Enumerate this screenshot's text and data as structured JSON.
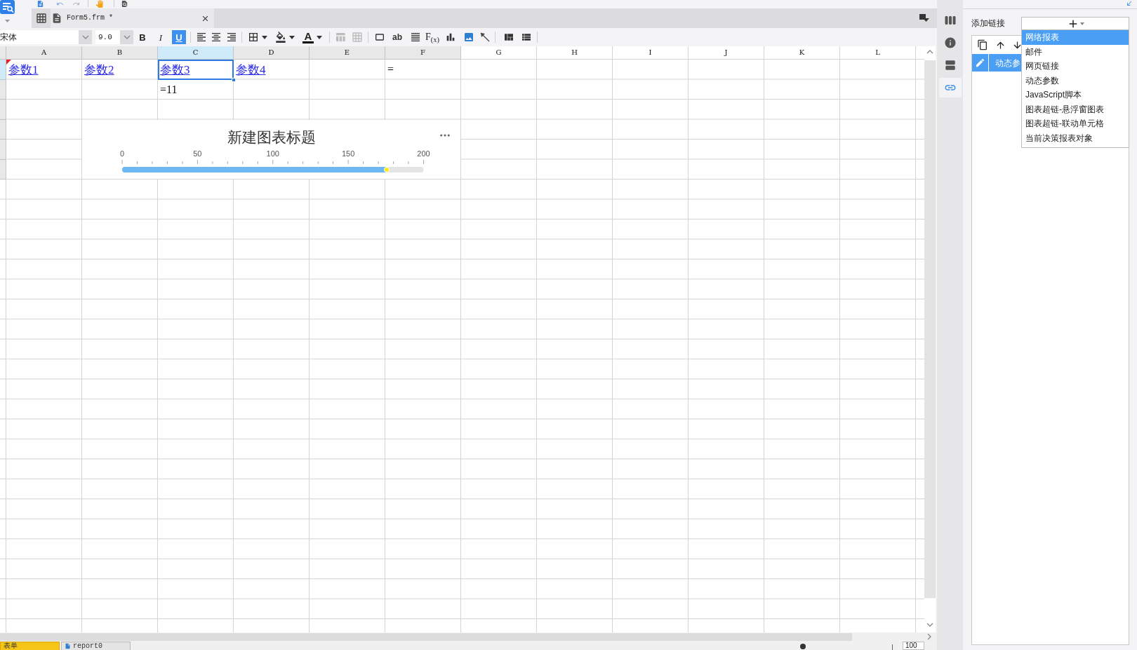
{
  "document_tabs": [
    {
      "label": "Form5.frm *",
      "selected": true
    }
  ],
  "format_toolbar": {
    "font": "宋体",
    "font_size": "9.0",
    "style_buttons": [
      {
        "kind": "bold",
        "label": "B",
        "on": false
      },
      {
        "kind": "italic",
        "label": "I",
        "on": false
      },
      {
        "kind": "underline",
        "label": "U",
        "on": true
      }
    ],
    "font_color_label": "A",
    "text_label": "ab",
    "formula_label": "F$_{(x)}$"
  },
  "sheet": {
    "columns": [
      {
        "label": "A",
        "selected": false,
        "used": true
      },
      {
        "label": "B",
        "selected": false,
        "used": true
      },
      {
        "label": "C",
        "selected": true,
        "used": true
      },
      {
        "label": "D",
        "selected": false,
        "used": true
      },
      {
        "label": "E",
        "selected": false,
        "used": true
      },
      {
        "label": "F",
        "selected": false,
        "used": true
      },
      {
        "label": "G",
        "selected": false,
        "used": false
      },
      {
        "label": "H",
        "selected": false,
        "used": false
      },
      {
        "label": "I",
        "selected": false,
        "used": false
      },
      {
        "label": "J",
        "selected": false,
        "used": false
      },
      {
        "label": "K",
        "selected": false,
        "used": false
      },
      {
        "label": "L",
        "selected": false,
        "used": false
      }
    ],
    "rows": [
      {
        "selected": true,
        "cells": [
          {
            "kind": "link",
            "text": "参数1",
            "selected": false,
            "flag": true
          },
          {
            "kind": "link",
            "text": "参数2",
            "selected": false,
            "flag": false
          },
          {
            "kind": "link",
            "text": "参数3",
            "selected": true,
            "flag": false
          },
          {
            "kind": "link",
            "text": "参数4",
            "selected": false,
            "flag": false
          },
          {
            "selected": false,
            "flag": false
          },
          {
            "kind": "text",
            "text": "=",
            "selected": false,
            "flag": false
          }
        ]
      },
      {
        "selected": false,
        "cells": [
          {
            "selected": false,
            "flag": false
          },
          {
            "selected": false,
            "flag": false
          },
          {
            "kind": "text",
            "text": "=11",
            "selected": false,
            "flag": false
          }
        ]
      },
      {
        "selected": false
      },
      {
        "selected": false
      },
      {
        "selected": false
      },
      {
        "selected": false
      }
    ]
  },
  "chart": {
    "chart_data": {
      "type": "bar",
      "orientation": "horizontal",
      "title": "新建图表标题",
      "xlim": [
        0,
        200
      ],
      "xticks": [
        0,
        50,
        100,
        150,
        200
      ],
      "grid": false,
      "series": [
        {
          "color": "#6cb8f4",
          "values": [
            176
          ]
        }
      ]
    }
  },
  "side_tabs": [
    {
      "kind": "layout",
      "selected": false
    },
    {
      "kind": "info",
      "selected": false
    },
    {
      "kind": "rows",
      "selected": false
    },
    {
      "kind": "link",
      "selected": true
    }
  ],
  "link_panel": {
    "label": "添加链接",
    "links": [
      {
        "text": "动态参",
        "selected": true
      }
    ],
    "add_menu": [
      {
        "label": "网络报表",
        "selected": true
      },
      {
        "label": "邮件",
        "selected": false
      },
      {
        "label": "网页链接",
        "selected": false
      },
      {
        "label": "动态参数",
        "selected": false
      },
      {
        "label": "JavaScript脚本",
        "selected": false
      },
      {
        "label": "图表超链-悬浮窗图表",
        "selected": false
      },
      {
        "label": "图表超链-联动单元格",
        "selected": false
      },
      {
        "label": "当前决策报表对象",
        "selected": false
      }
    ]
  },
  "sheet_tabs": [
    {
      "label": "表单",
      "selected": true
    },
    {
      "label": "report0",
      "selected": false
    }
  ],
  "zoom": {
    "value": "100"
  }
}
